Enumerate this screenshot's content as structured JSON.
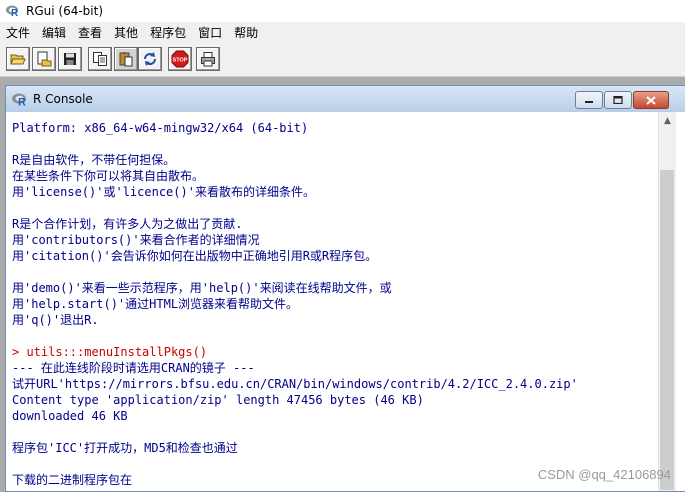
{
  "app": {
    "title": "RGui (64-bit)",
    "menus": [
      "文件",
      "编辑",
      "查看",
      "其他",
      "程序包",
      "窗口",
      "帮助"
    ]
  },
  "toolbar": {
    "buttons": [
      "open-script",
      "load-workspace",
      "save-workspace",
      "copy",
      "paste",
      "copy-paste",
      "stop",
      "print"
    ],
    "stop_label": "STOP"
  },
  "console": {
    "title": "R Console",
    "lines": [
      {
        "kind": "out",
        "text": "Platform: x86_64-w64-mingw32/x64 (64-bit)"
      },
      {
        "kind": "out",
        "text": ""
      },
      {
        "kind": "out",
        "text": "R是自由软件，不带任何担保。"
      },
      {
        "kind": "out",
        "text": "在某些条件下你可以将其自由散布。"
      },
      {
        "kind": "out",
        "text": "用'license()'或'licence()'来看散布的详细条件。"
      },
      {
        "kind": "out",
        "text": ""
      },
      {
        "kind": "out",
        "text": "R是个合作计划，有许多人为之做出了贡献."
      },
      {
        "kind": "out",
        "text": "用'contributors()'来看合作者的详细情况"
      },
      {
        "kind": "out",
        "text": "用'citation()'会告诉你如何在出版物中正确地引用R或R程序包。"
      },
      {
        "kind": "out",
        "text": ""
      },
      {
        "kind": "out",
        "text": "用'demo()'来看一些示范程序，用'help()'来阅读在线帮助文件，或"
      },
      {
        "kind": "out",
        "text": "用'help.start()'通过HTML浏览器来看帮助文件。"
      },
      {
        "kind": "out",
        "text": "用'q()'退出R."
      },
      {
        "kind": "out",
        "text": ""
      },
      {
        "kind": "inp",
        "text": "> utils:::menuInstallPkgs()"
      },
      {
        "kind": "out",
        "text": "--- 在此连线阶段时请选用CRAN的镜子 ---"
      },
      {
        "kind": "out",
        "text": "试开URL'https://mirrors.bfsu.edu.cn/CRAN/bin/windows/contrib/4.2/ICC_2.4.0.zip'"
      },
      {
        "kind": "out",
        "text": "Content type 'application/zip' length 47456 bytes (46 KB)"
      },
      {
        "kind": "out",
        "text": "downloaded 46 KB"
      },
      {
        "kind": "out",
        "text": ""
      },
      {
        "kind": "out",
        "text": "程序包'ICC'打开成功，MD5和检查也通过"
      },
      {
        "kind": "out",
        "text": ""
      },
      {
        "kind": "out",
        "text": "下载的二进制程序包在"
      }
    ]
  },
  "watermark": "CSDN @qq_42106894",
  "colors": {
    "output_text": "#00008b",
    "input_text": "#cc0000",
    "mdi_background": "#ababab"
  }
}
